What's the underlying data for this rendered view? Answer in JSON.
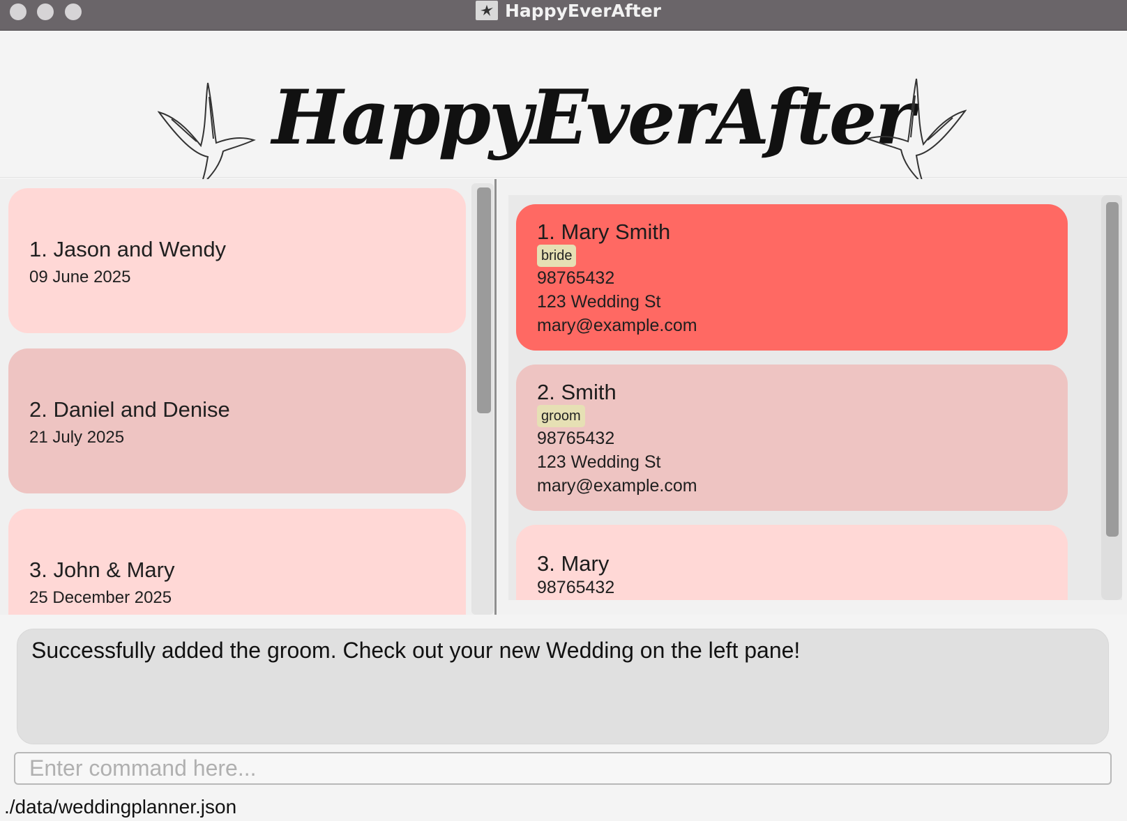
{
  "window": {
    "title": "HappyEverAfter",
    "icon": "dove-app-icon"
  },
  "banner": {
    "title": "HappyEverAfter",
    "left_icon": "dove-icon",
    "right_icon": "dove-icon"
  },
  "weddings": [
    {
      "title": "1. Jason and Wendy",
      "date": "09 June 2025"
    },
    {
      "title": "2. Daniel and Denise",
      "date": "21 July 2025"
    },
    {
      "title": "3. John & Mary",
      "date": "25 December 2025"
    }
  ],
  "persons": [
    {
      "name": "1. Mary Smith",
      "tag": "bride",
      "phone": "98765432",
      "address": "123 Wedding St",
      "email": "mary@example.com"
    },
    {
      "name": "2. Smith",
      "tag": "groom",
      "phone": "98765432",
      "address": "123 Wedding St",
      "email": "mary@example.com"
    },
    {
      "name": "3. Mary",
      "phone": "98765432"
    }
  ],
  "result": {
    "message": "Successfully added the groom. Check out your new Wedding on the left pane!"
  },
  "command": {
    "placeholder": "Enter command here...",
    "value": ""
  },
  "status": {
    "file_path": "./data/weddingplanner.json"
  },
  "colors": {
    "selected_card": "#ff6963",
    "card_light": "#ffd8d6",
    "card_dark": "#eec4c2",
    "tag_bg": "#e6e0b4",
    "titlebar": "#6a6569"
  }
}
